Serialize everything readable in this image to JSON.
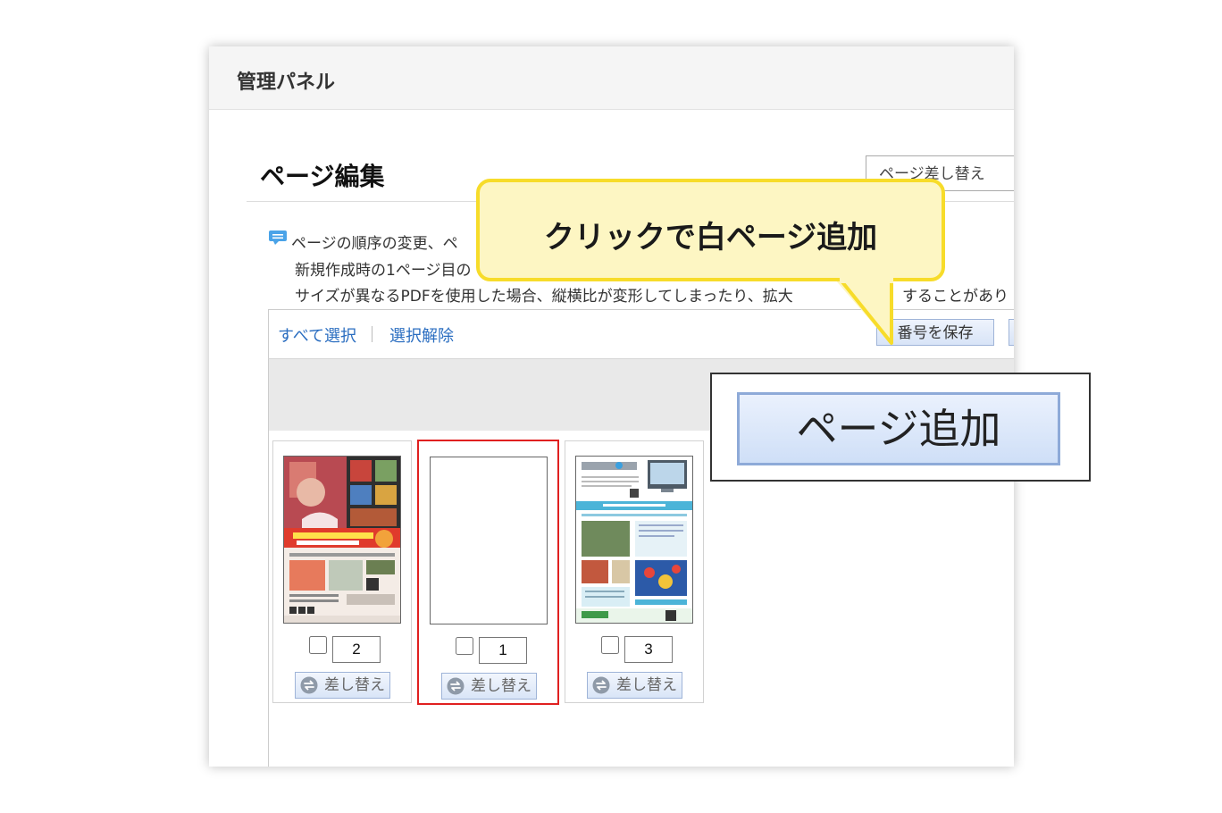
{
  "panel": {
    "title": "管理パネル"
  },
  "editor": {
    "section_title": "ページ編集",
    "replace_page_button": "ページ差し替え",
    "info": {
      "line1": "ページの順序の変更、ペ",
      "line2": "新規作成時の1ページ目の",
      "line3a": "サイズが異なるPDFを使用した場合、縦横比が変形してしまったり、拡大",
      "line3b": "することがあり"
    },
    "toolbar": {
      "select_all": "すべて選択",
      "deselect": "選択解除",
      "save_numbers": "番号を保存"
    },
    "pages": [
      {
        "number": "2",
        "replace_label": "差し替え",
        "thumbnail": "tourism-flyer",
        "selected": false
      },
      {
        "number": "1",
        "replace_label": "差し替え",
        "thumbnail": "blank-page",
        "selected": true
      },
      {
        "number": "3",
        "replace_label": "差し替え",
        "thumbnail": "wisebook-brochure",
        "selected": false
      }
    ]
  },
  "overlay": {
    "callout_text": "クリックで白ページ追加",
    "zoom_button": "ページ追加"
  },
  "colors": {
    "link": "#2a6dc0",
    "callout_fill": "#fdf6c3",
    "callout_border": "#f7dc2a",
    "selected_border": "#e02020",
    "button_border": "#9fb4d8"
  },
  "icons": [
    "comment-icon",
    "swap-arrows-icon"
  ]
}
